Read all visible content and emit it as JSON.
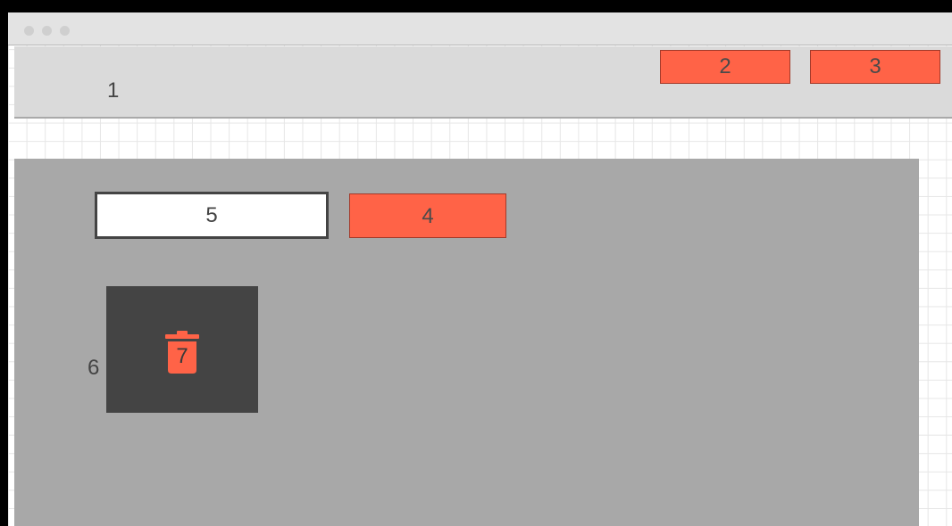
{
  "header": {
    "label": "1"
  },
  "toolbar": {
    "button_2": "2",
    "button_3": "3"
  },
  "form": {
    "input_value": "5",
    "submit_label": "4"
  },
  "tile": {
    "side_label": "6",
    "trash_label": "7"
  },
  "colors": {
    "accent": "#ff6347",
    "header_bg": "#dadada",
    "content_bg": "#a8a8a8",
    "tile_bg": "#444444"
  }
}
